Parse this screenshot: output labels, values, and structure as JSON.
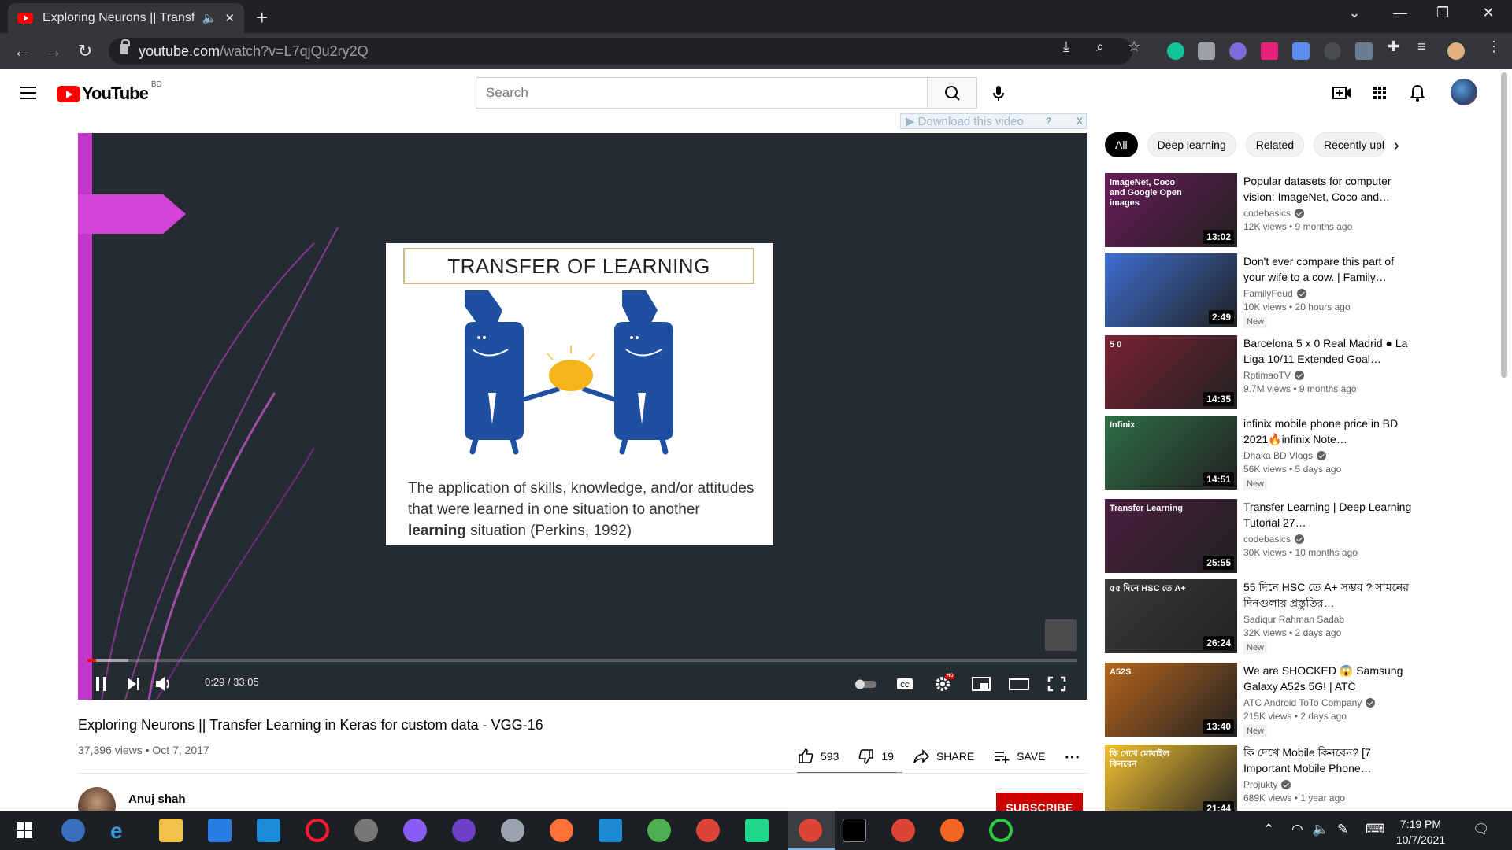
{
  "browser": {
    "tab_title": "Exploring Neurons || Transfer Learning in Keras",
    "new_tab": "+",
    "url_host": "youtube.com",
    "url_path": "/watch?v=L7qjQu2ry2Q"
  },
  "masthead": {
    "logo_text": "YouTube",
    "country": "BD",
    "search_placeholder": "Search"
  },
  "download_bar": {
    "label": "Download this video",
    "help": "?",
    "close": "X"
  },
  "player": {
    "slide_title": "TRANSFER OF LEARNING",
    "slide_text_1": "The application of skills, knowledge, and/or attitudes that were learned in one situation to another ",
    "slide_text_bold": "learning",
    "slide_text_2": " situation (Perkins, 1992)",
    "time": "0:29 / 33:05",
    "progress_played_fraction": 0.009,
    "hd_badge": "HD"
  },
  "video": {
    "title": "Exploring Neurons || Transfer Learning in Keras for custom data - VGG-16",
    "views_date": "37,396 views • Oct 7, 2017",
    "likes": "593",
    "dislikes": "19",
    "share": "SHARE",
    "save": "SAVE",
    "channel": "Anuj shah",
    "subscribe": "SUBSCRIBE"
  },
  "chips": [
    "All",
    "Deep learning",
    "Related",
    "Recently upl"
  ],
  "recommendations": [
    {
      "title": "Popular datasets for computer vision: ImageNet, Coco and…",
      "channel": "codebasics",
      "verified": true,
      "meta": "12K views • 9 months ago",
      "duration": "13:02",
      "badge": "",
      "thumb_text": "ImageNet, Coco and Google Open images",
      "thumb_color": "#6a1b5a"
    },
    {
      "title": "Don't ever compare this part of your wife to a cow. | Family…",
      "channel": "FamilyFeud",
      "verified": true,
      "meta": "10K views • 20 hours ago",
      "duration": "2:49",
      "badge": "New",
      "thumb_text": "",
      "thumb_color": "#3d6fd1"
    },
    {
      "title": "Barcelona 5 x 0 Real Madrid ● La Liga 10/11 Extended Goal…",
      "channel": "RptimaoTV",
      "verified": true,
      "meta": "9.7M views • 9 months ago",
      "duration": "14:35",
      "badge": "",
      "thumb_text": "5 0",
      "thumb_color": "#7a2232"
    },
    {
      "title": "infinix mobile phone price in BD 2021🔥infinix Note…",
      "channel": "Dhaka BD Vlogs",
      "verified": true,
      "meta": "56K views • 5 days ago",
      "duration": "14:51",
      "badge": "New",
      "thumb_text": "Infinix",
      "thumb_color": "#2f6f45"
    },
    {
      "title": "Transfer Learning | Deep Learning Tutorial 27…",
      "channel": "codebasics",
      "verified": true,
      "meta": "30K views • 10 months ago",
      "duration": "25:55",
      "badge": "",
      "thumb_text": "Transfer Learning",
      "thumb_color": "#4a1e3f"
    },
    {
      "title": "55 দিনে HSC তে A+ সম্ভব ? সামনের দিনগুলায় প্রস্তুতির…",
      "channel": "Sadiqur Rahman Sadab",
      "verified": false,
      "meta": "32K views • 2 days ago",
      "duration": "26:24",
      "badge": "New",
      "thumb_text": "৫৫ দিনে HSC তে A+",
      "thumb_color": "#3a3a3a"
    },
    {
      "title": "We are SHOCKED 😱 Samsung Galaxy A52s 5G! | ATC",
      "channel": "ATC Android ToTo Company",
      "verified": true,
      "meta": "215K views • 2 days ago",
      "duration": "13:40",
      "badge": "New",
      "thumb_text": "A52S",
      "thumb_color": "#b5651d"
    },
    {
      "title": "কি দেখে Mobile কিনবেন? [7 Important Mobile Phone…",
      "channel": "Projukty",
      "verified": true,
      "meta": "689K views • 1 year ago",
      "duration": "21:44",
      "badge": "",
      "thumb_text": "কি দেখে মোবাইল কিনবেন",
      "thumb_color": "#f2c12e"
    }
  ],
  "taskbar": {
    "time": "7:19 PM",
    "date": "10/7/2021"
  }
}
